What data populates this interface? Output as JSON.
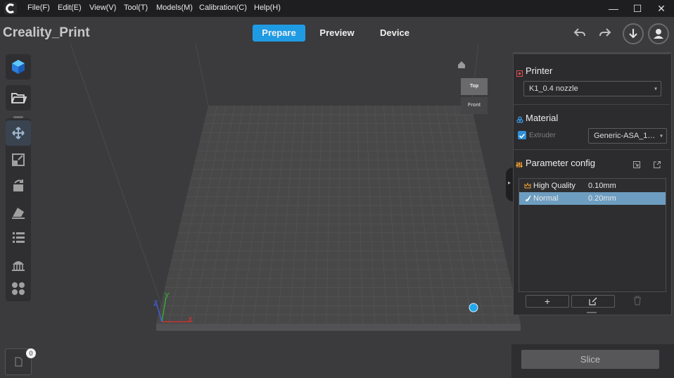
{
  "menubar": {
    "items": [
      "File(F)",
      "Edit(E)",
      "View(V)",
      "Tool(T)",
      "Models(M)",
      "Calibration(C)",
      "Help(H)"
    ],
    "window_controls": [
      "—",
      "☐",
      "✕"
    ]
  },
  "app": {
    "title": "Creality_Print"
  },
  "tabs": [
    {
      "label": "Prepare",
      "active": true
    },
    {
      "label": "Preview",
      "active": false
    },
    {
      "label": "Device",
      "active": false
    }
  ],
  "viewcube": {
    "top": "Top",
    "front": "Front"
  },
  "axes": {
    "x": "X",
    "y": "Y",
    "z": "Z"
  },
  "printer": {
    "title": "Printer",
    "selected": "K1_0.4 nozzle"
  },
  "material": {
    "title": "Material",
    "extruder_label": "Extruder",
    "extruder_checked": true,
    "selected": "Generic-ASA_1…"
  },
  "parameter_config": {
    "title": "Parameter config",
    "rows": [
      {
        "name": "High Quality",
        "value": "0.10mm",
        "selected": false
      },
      {
        "name": "Normal",
        "value": "0.20mm",
        "selected": true
      }
    ]
  },
  "slice": {
    "label": "Slice"
  },
  "doc_badge": "0",
  "colors": {
    "accent": "#1f9be4",
    "selected_row": "#6d9dc1",
    "bed": "#4a4a4c"
  }
}
